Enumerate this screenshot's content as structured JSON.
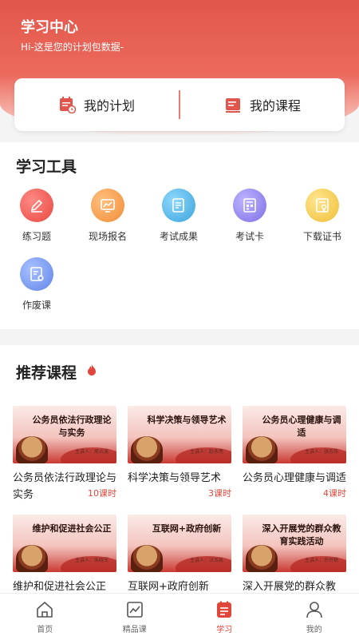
{
  "header": {
    "title": "学习中心",
    "subtitle": "Hi-这是您的计划包数据-"
  },
  "plan": {
    "my_plan": "我的计划",
    "my_courses": "我的课程"
  },
  "tools": {
    "title": "学习工具",
    "items": [
      {
        "label": "练习题",
        "icon": "edit-icon",
        "color": "#ef5f5a"
      },
      {
        "label": "现场报名",
        "icon": "chart-board-icon",
        "color": "#f5a65b"
      },
      {
        "label": "考试成果",
        "icon": "document-icon",
        "color": "#5fbde9"
      },
      {
        "label": "考试卡",
        "icon": "card-grid-icon",
        "color": "#9a8ef0"
      },
      {
        "label": "下载证书",
        "icon": "certificate-icon",
        "color": "#f3ce5c"
      },
      {
        "label": "作废课",
        "icon": "document-cancel-icon",
        "color": "#7e9ef2"
      }
    ]
  },
  "recommend": {
    "title": "推荐课程",
    "courses": [
      {
        "thumb_text": "公务员依法行政理论与实务",
        "author": "主讲人：周占波",
        "title": "公务员依法行政理论与实务",
        "hours": "10课时"
      },
      {
        "thumb_text": "科学决策与领导艺术",
        "author": "主讲人：赵永亮",
        "title": "科学决策与领导艺术",
        "hours": "3课时"
      },
      {
        "thumb_text": "公务员心理健康与调适",
        "author": "主讲人：张志伟",
        "title": "公务员心理健康与调适",
        "hours": "4课时"
      },
      {
        "thumb_text": "维护和促进社会公正",
        "author": "主讲人：朱晓军",
        "title": "维护和促进社会公正",
        "hours": ""
      },
      {
        "thumb_text": "互联网+政府创新",
        "author": "主讲人：汪玉凯",
        "title": "互联网+政府创新",
        "hours": ""
      },
      {
        "thumb_text": "深入开展党的群众教育实践活动",
        "author": "主讲人：许开轶",
        "title": "深入开展党的群众教",
        "hours": ""
      }
    ]
  },
  "tabbar": {
    "items": [
      {
        "label": "首页",
        "icon": "home-icon"
      },
      {
        "label": "精品课",
        "icon": "trend-icon"
      },
      {
        "label": "学习",
        "icon": "study-list-icon",
        "active": true
      },
      {
        "label": "我的",
        "icon": "user-icon"
      }
    ]
  },
  "colors": {
    "accent": "#e0463a",
    "header": "#e2564b"
  }
}
